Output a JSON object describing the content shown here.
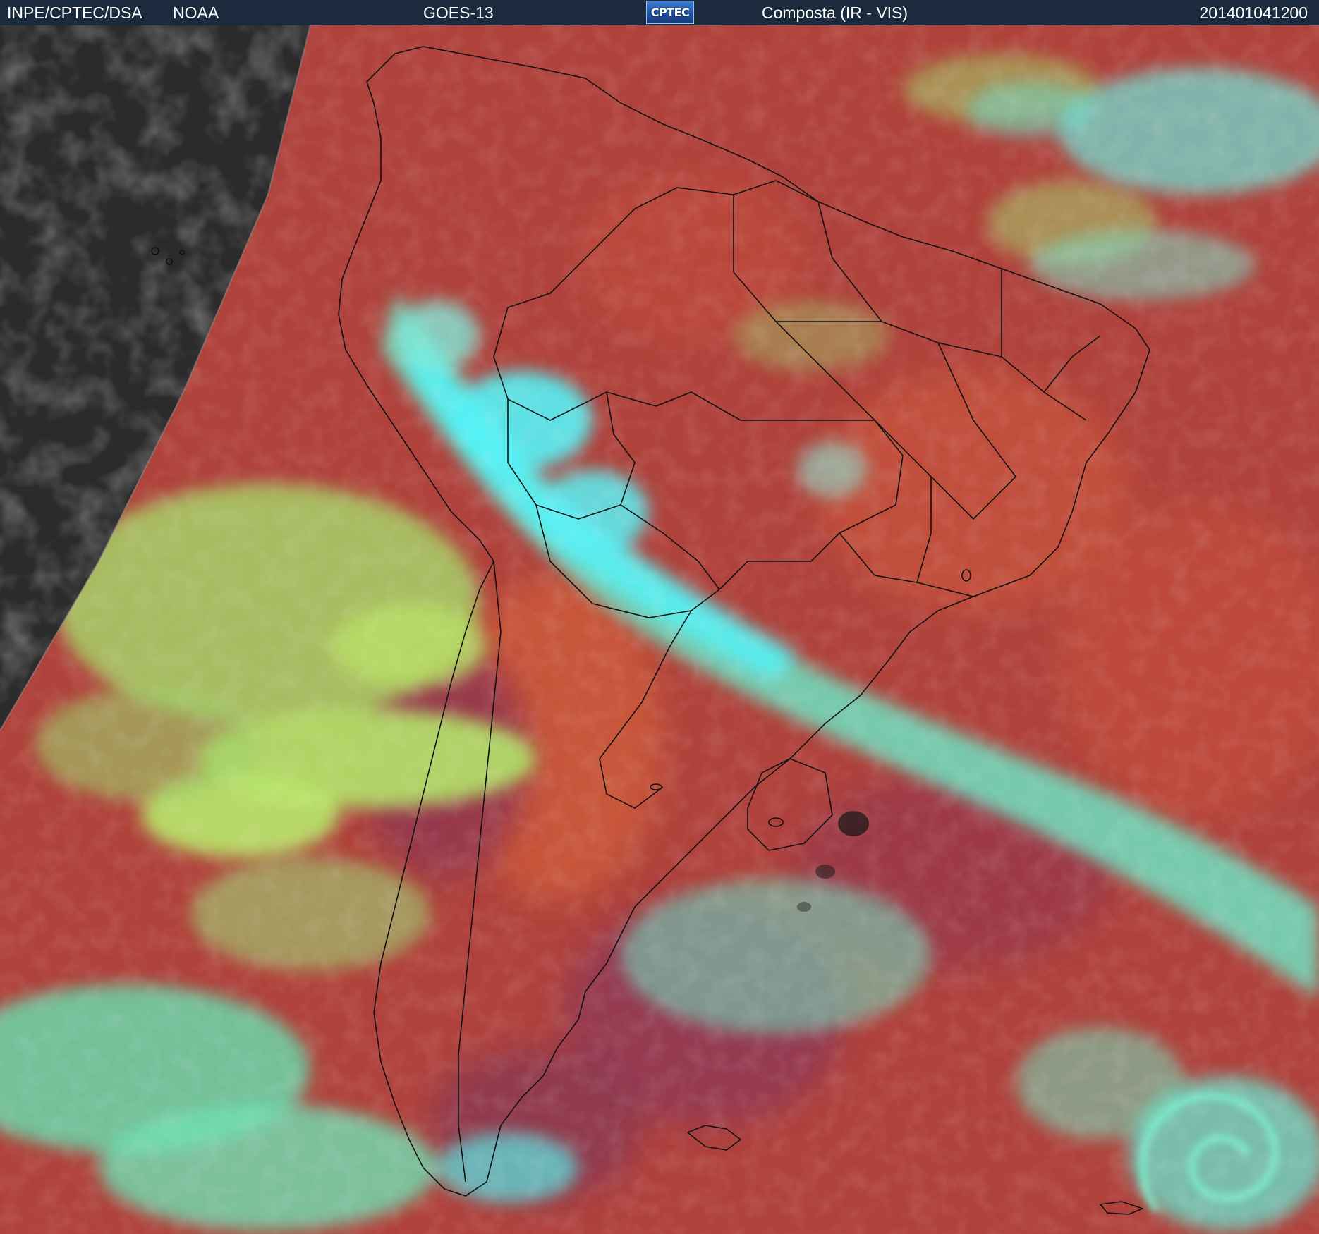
{
  "header": {
    "organization": "INPE/CPTEC/DSA",
    "agency": "NOAA",
    "satellite": "GOES-13",
    "logo_text": "CPTEC",
    "product": "Composta (IR - VIS)",
    "timestamp": "201401041200"
  },
  "colors": {
    "header_bg": "#1b2a3c",
    "clear_sky": "#b0423c",
    "low_clouds": "#a8e060",
    "high_clouds": "#4ff0f0",
    "night_side": "#2b2b2b",
    "borders": "#111111"
  }
}
